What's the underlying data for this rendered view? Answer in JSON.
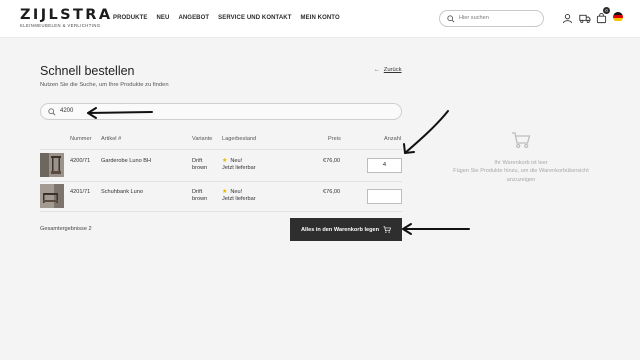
{
  "header": {
    "logo": {
      "word": "ZIJLSTRA",
      "tagline": "KLEINMEUBELEN & VERLICHTING"
    },
    "nav": [
      "PRODUKTE",
      "NEU",
      "ANGEBOT",
      "SERVICE UND KONTAKT",
      "MEIN KONTO"
    ],
    "search": {
      "placeholder": "Hier suchen"
    },
    "icons": [
      "user-icon",
      "truck-icon",
      "cart-icon",
      "flag-de-icon"
    ],
    "cart_badge": "0"
  },
  "main": {
    "title": "Schnell bestellen",
    "subtitle": "Nutzen Sie die Suche, um Ihre Produkte zu finden",
    "back_label": "Zurück",
    "quick_search_value": "4200",
    "table": {
      "headers": [
        "Nummer",
        "Artikel #",
        "Variante",
        "Lagerbestand",
        "Preis",
        "Anzahl"
      ],
      "rows": [
        {
          "number": "4200/71",
          "article": "Garderobe Luno BH",
          "variant_line1": "Drift",
          "variant_line2": "brown",
          "stock_line1": "Neu!",
          "stock_line2": "Jetzt lieferbar",
          "price": "€76,00",
          "qty": "4"
        },
        {
          "number": "4201/71",
          "article": "Schuhbank Luno",
          "variant_line1": "Drift",
          "variant_line2": "brown",
          "stock_line1": "Neu!",
          "stock_line2": "Jetzt lieferbar",
          "price": "€76,00",
          "qty": ""
        }
      ]
    },
    "total_label": "Gesamtergebnisse 2",
    "cta_label": "Alles in den Warenkorb legen"
  },
  "cart_panel": {
    "empty_title": "Ihr Warenkorb ist leer",
    "empty_text_line1": "Fügen Sie Produkte hinzu, um die Warenkorbübersicht",
    "empty_text_line2": "anzuzeigen"
  },
  "colors": {
    "cta_bg": "#2e2e2e",
    "page_bg": "#f4f4f4",
    "star": "#e1b400",
    "annotation": "#111111"
  }
}
